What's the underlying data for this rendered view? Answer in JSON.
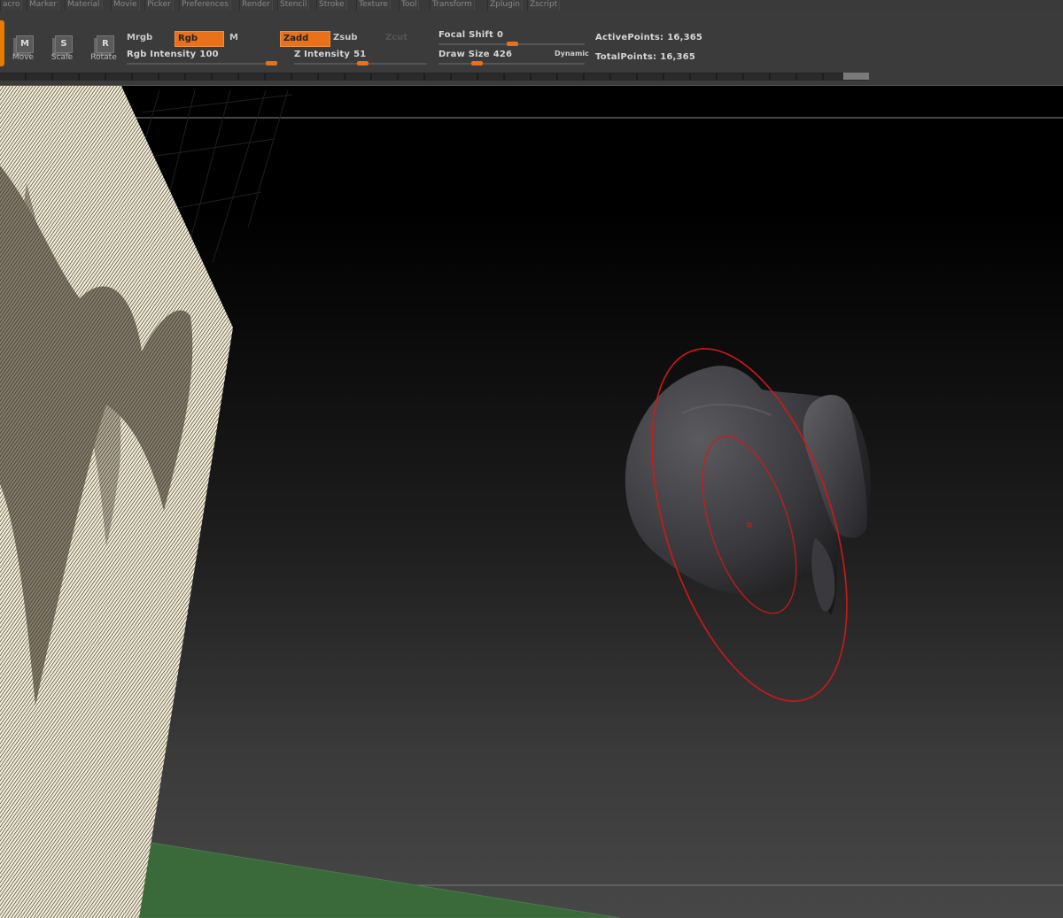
{
  "menubar": {
    "items": [
      "acro",
      "Marker",
      "Material",
      "Movie",
      "Picker",
      "Preferences",
      "Render",
      "Stencil",
      "Stroke",
      "Texture",
      "Tool",
      "Transform",
      "Zplugin",
      "Zscript"
    ]
  },
  "toolbar": {
    "move": {
      "label": "Move",
      "key": "M"
    },
    "scale": {
      "label": "Scale",
      "key": "S"
    },
    "rotate": {
      "label": "Rotate",
      "key": "R"
    },
    "mrgb": "Mrgb",
    "rgb": "Rgb",
    "m": "M",
    "zadd": "Zadd",
    "zsub": "Zsub",
    "zcut": "Zcut",
    "rgb_intensity": {
      "label": "Rgb Intensity",
      "value": "100",
      "level": 1.0
    },
    "z_intensity": {
      "label": "Z Intensity",
      "value": "51",
      "level": 0.51
    },
    "focal_shift": {
      "label": "Focal Shift",
      "value": "0",
      "level": 0.5
    },
    "draw_size": {
      "label": "Draw Size",
      "value": "426",
      "level": 0.26
    },
    "dynamic": "Dynamic",
    "active_points": {
      "label": "ActivePoints:",
      "value": "16,365"
    },
    "total_points": {
      "label": "TotalPoints:",
      "value": "16,365"
    }
  },
  "colors": {
    "accent": "#e8711a",
    "panel": "#3b3b3b",
    "brush_cursor": "#d01818",
    "ground": "#3a6a3a",
    "image_plane": "#e8e0c0"
  },
  "viewport": {
    "model": "sculpted-mesh",
    "brush_cursor": "draw-brush-cursor"
  }
}
